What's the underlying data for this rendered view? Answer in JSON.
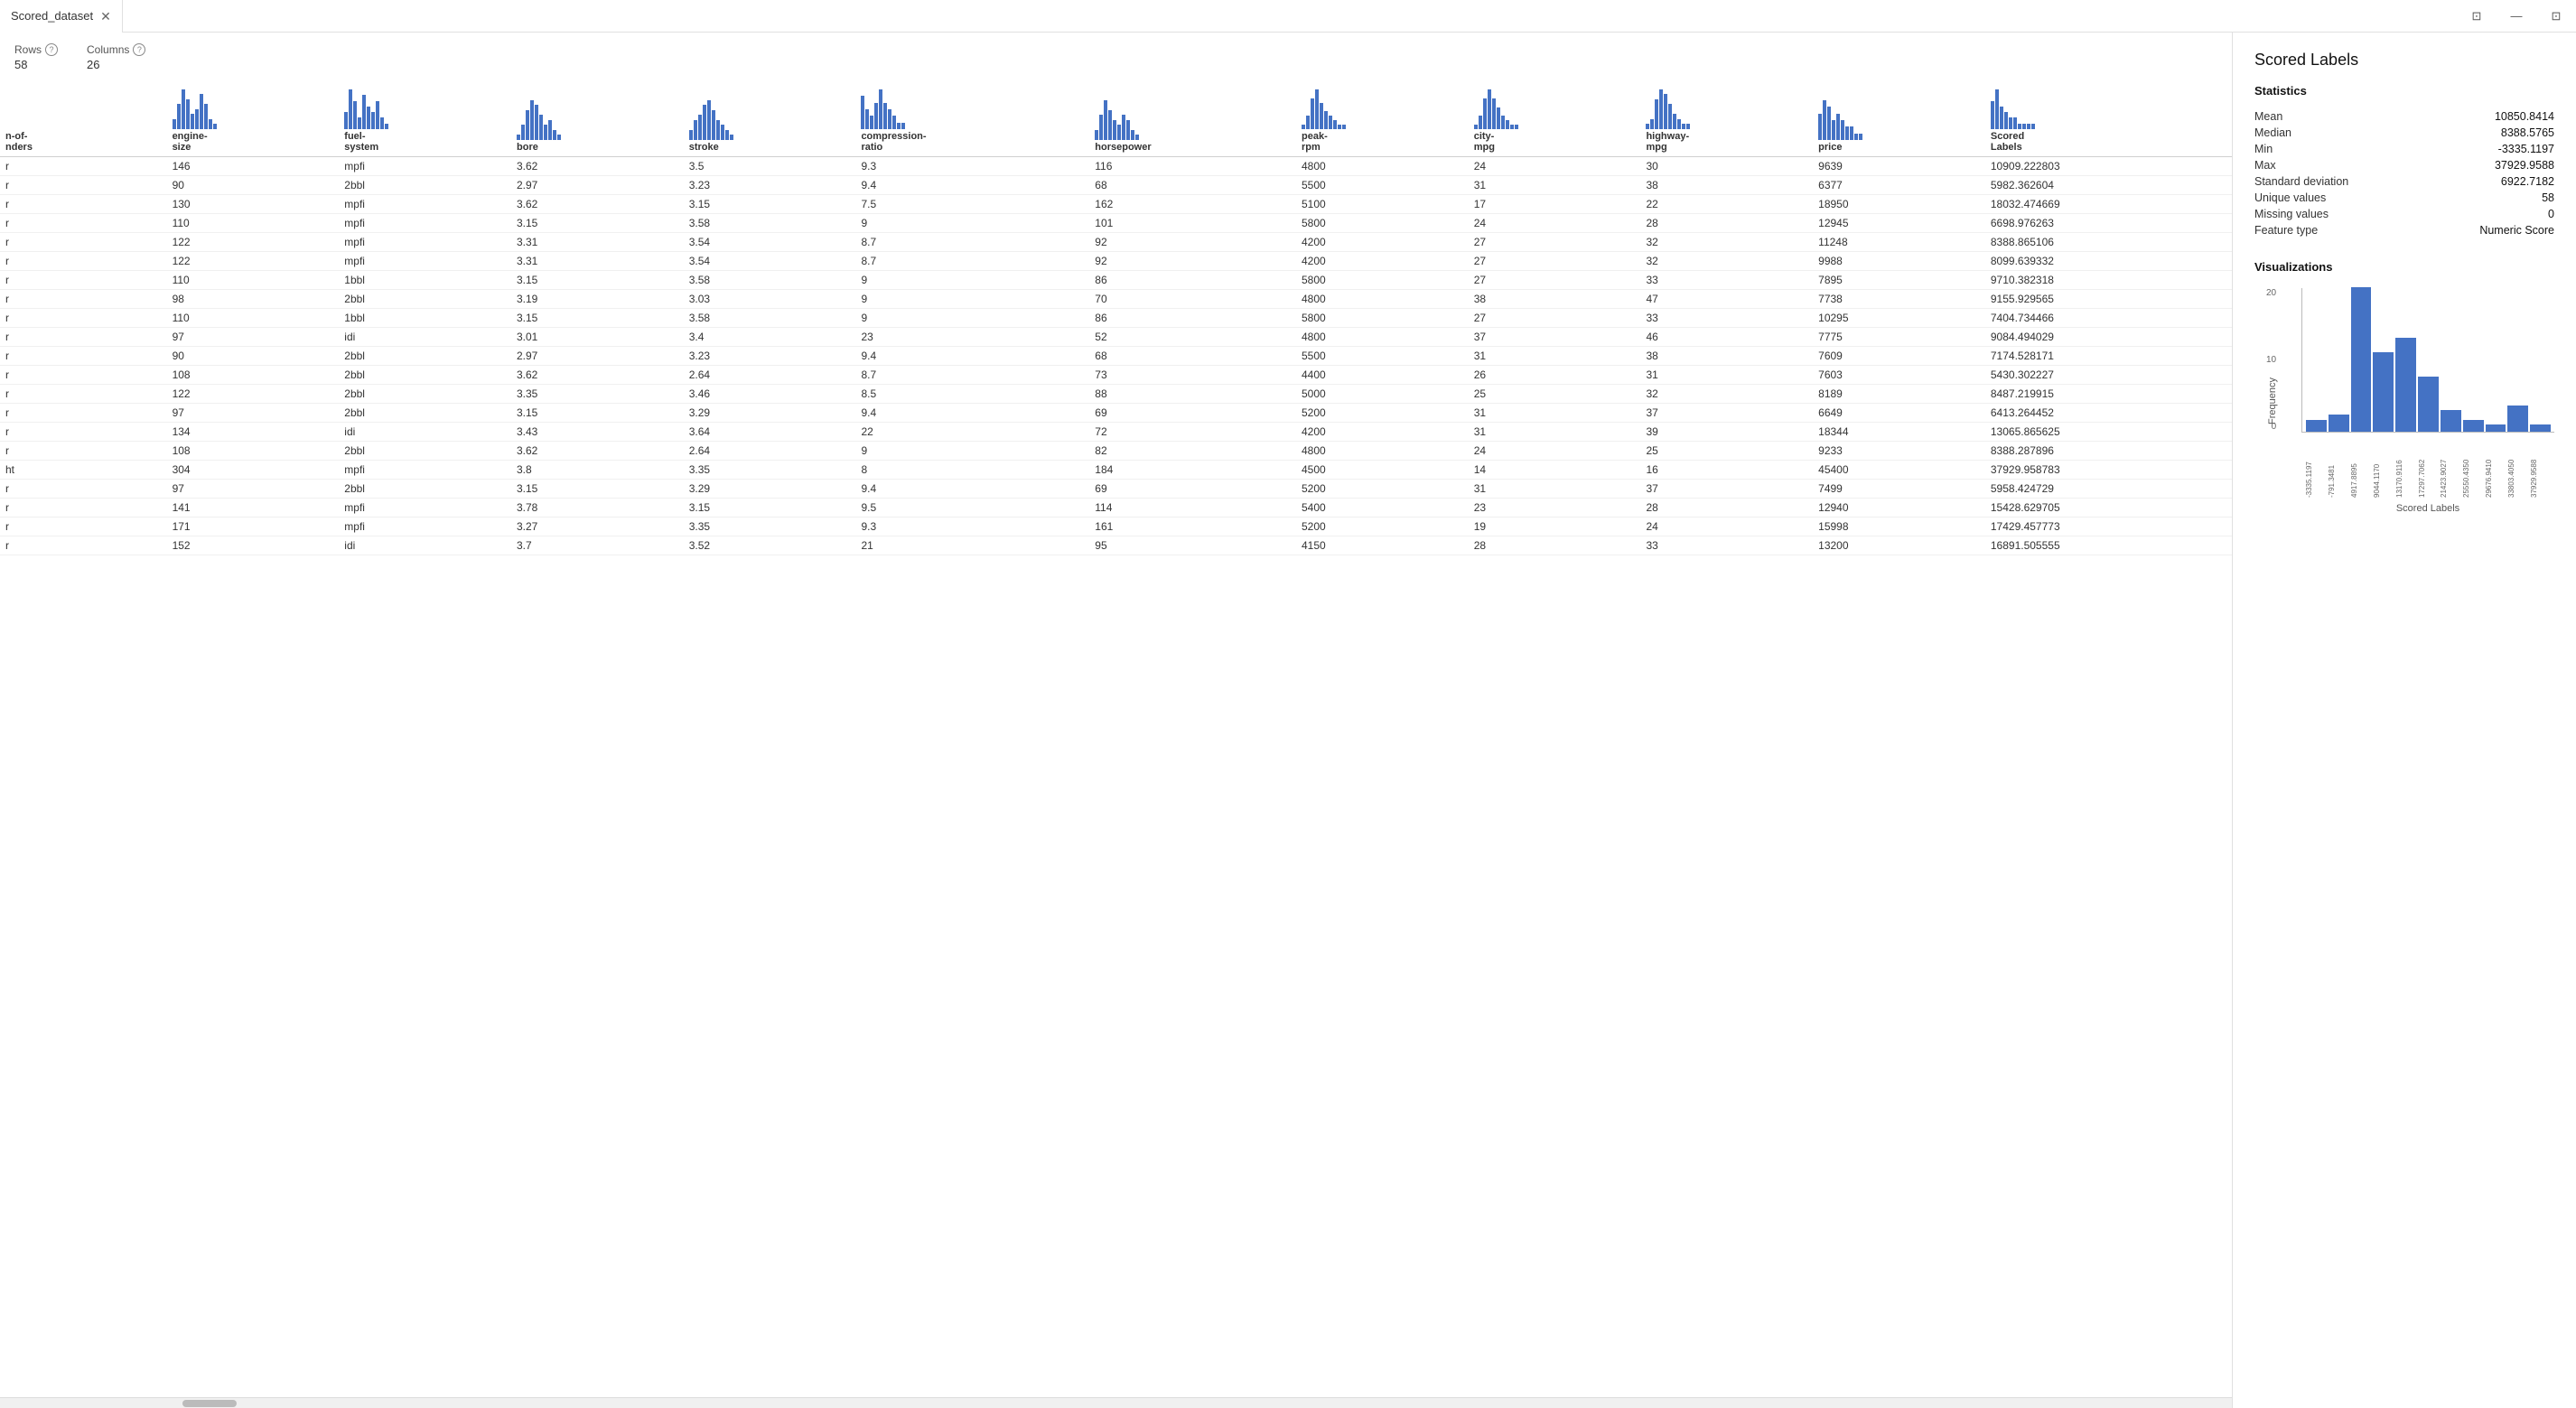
{
  "titleBar": {
    "tabName": "Scored_dataset",
    "closeIcon": "✕",
    "winControls": [
      "⊡",
      "—",
      "⊡"
    ]
  },
  "meta": {
    "rowsLabel": "Rows",
    "rowsValue": "58",
    "colsLabel": "Columns",
    "colsValue": "26"
  },
  "table": {
    "columns": [
      {
        "key": "num-of-cylinders",
        "label": "n-of-\nnders"
      },
      {
        "key": "engine-size",
        "label": "engine-\nsize"
      },
      {
        "key": "fuel-system",
        "label": "fuel-\nsystem"
      },
      {
        "key": "bore",
        "label": "bore"
      },
      {
        "key": "stroke",
        "label": "stroke"
      },
      {
        "key": "compression-ratio",
        "label": "compression-\nratio"
      },
      {
        "key": "horsepower",
        "label": "horsepower"
      },
      {
        "key": "peak-rpm",
        "label": "peak-\nrpm"
      },
      {
        "key": "city-mpg",
        "label": "city-\nmpg"
      },
      {
        "key": "highway-mpg",
        "label": "highway-\nmpg"
      },
      {
        "key": "price",
        "label": "price"
      },
      {
        "key": "scored-labels",
        "label": "Scored\nLabels"
      }
    ],
    "sparklines": {
      "engine-size": [
        2,
        5,
        8,
        6,
        3,
        4,
        7,
        5,
        2,
        1
      ],
      "fuel-system": [
        3,
        7,
        5,
        2,
        6,
        4,
        3,
        5,
        2,
        1
      ],
      "bore": [
        1,
        3,
        6,
        8,
        7,
        5,
        3,
        4,
        2,
        1
      ],
      "stroke": [
        2,
        4,
        5,
        7,
        8,
        6,
        4,
        3,
        2,
        1
      ],
      "compression-ratio": [
        5,
        3,
        2,
        4,
        6,
        4,
        3,
        2,
        1,
        1
      ],
      "horsepower": [
        2,
        5,
        8,
        6,
        4,
        3,
        5,
        4,
        2,
        1
      ],
      "peak-rpm": [
        1,
        3,
        7,
        9,
        6,
        4,
        3,
        2,
        1,
        1
      ],
      "city-mpg": [
        1,
        3,
        7,
        9,
        7,
        5,
        3,
        2,
        1,
        1
      ],
      "highway-mpg": [
        1,
        2,
        6,
        8,
        7,
        5,
        3,
        2,
        1,
        1
      ],
      "price": [
        4,
        6,
        5,
        3,
        4,
        3,
        2,
        2,
        1,
        1
      ],
      "scored-labels": [
        5,
        7,
        4,
        3,
        2,
        2,
        1,
        1,
        1,
        1
      ]
    },
    "rows": [
      [
        "r",
        "146",
        "mpfi",
        "3.62",
        "3.5",
        "9.3",
        "116",
        "4800",
        "24",
        "30",
        "9639",
        "10909.222803"
      ],
      [
        "r",
        "90",
        "2bbl",
        "2.97",
        "3.23",
        "9.4",
        "68",
        "5500",
        "31",
        "38",
        "6377",
        "5982.362604"
      ],
      [
        "r",
        "130",
        "mpfi",
        "3.62",
        "3.15",
        "7.5",
        "162",
        "5100",
        "17",
        "22",
        "18950",
        "18032.474669"
      ],
      [
        "r",
        "110",
        "mpfi",
        "3.15",
        "3.58",
        "9",
        "101",
        "5800",
        "24",
        "28",
        "12945",
        "6698.976263"
      ],
      [
        "r",
        "122",
        "mpfi",
        "3.31",
        "3.54",
        "8.7",
        "92",
        "4200",
        "27",
        "32",
        "11248",
        "8388.865106"
      ],
      [
        "r",
        "122",
        "mpfi",
        "3.31",
        "3.54",
        "8.7",
        "92",
        "4200",
        "27",
        "32",
        "9988",
        "8099.639332"
      ],
      [
        "r",
        "110",
        "1bbl",
        "3.15",
        "3.58",
        "9",
        "86",
        "5800",
        "27",
        "33",
        "7895",
        "9710.382318"
      ],
      [
        "r",
        "98",
        "2bbl",
        "3.19",
        "3.03",
        "9",
        "70",
        "4800",
        "38",
        "47",
        "7738",
        "9155.929565"
      ],
      [
        "r",
        "110",
        "1bbl",
        "3.15",
        "3.58",
        "9",
        "86",
        "5800",
        "27",
        "33",
        "10295",
        "7404.734466"
      ],
      [
        "r",
        "97",
        "idi",
        "3.01",
        "3.4",
        "23",
        "52",
        "4800",
        "37",
        "46",
        "7775",
        "9084.494029"
      ],
      [
        "r",
        "90",
        "2bbl",
        "2.97",
        "3.23",
        "9.4",
        "68",
        "5500",
        "31",
        "38",
        "7609",
        "7174.528171"
      ],
      [
        "r",
        "108",
        "2bbl",
        "3.62",
        "2.64",
        "8.7",
        "73",
        "4400",
        "26",
        "31",
        "7603",
        "5430.302227"
      ],
      [
        "r",
        "122",
        "2bbl",
        "3.35",
        "3.46",
        "8.5",
        "88",
        "5000",
        "25",
        "32",
        "8189",
        "8487.219915"
      ],
      [
        "r",
        "97",
        "2bbl",
        "3.15",
        "3.29",
        "9.4",
        "69",
        "5200",
        "31",
        "37",
        "6649",
        "6413.264452"
      ],
      [
        "r",
        "134",
        "idi",
        "3.43",
        "3.64",
        "22",
        "72",
        "4200",
        "31",
        "39",
        "18344",
        "13065.865625"
      ],
      [
        "r",
        "108",
        "2bbl",
        "3.62",
        "2.64",
        "9",
        "82",
        "4800",
        "24",
        "25",
        "9233",
        "8388.287896"
      ],
      [
        "ht",
        "304",
        "mpfi",
        "3.8",
        "3.35",
        "8",
        "184",
        "4500",
        "14",
        "16",
        "45400",
        "37929.958783"
      ],
      [
        "r",
        "97",
        "2bbl",
        "3.15",
        "3.29",
        "9.4",
        "69",
        "5200",
        "31",
        "37",
        "7499",
        "5958.424729"
      ],
      [
        "r",
        "141",
        "mpfi",
        "3.78",
        "3.15",
        "9.5",
        "114",
        "5400",
        "23",
        "28",
        "12940",
        "15428.629705"
      ],
      [
        "r",
        "171",
        "mpfi",
        "3.27",
        "3.35",
        "9.3",
        "161",
        "5200",
        "19",
        "24",
        "15998",
        "17429.457773"
      ],
      [
        "r",
        "152",
        "idi",
        "3.7",
        "3.52",
        "21",
        "95",
        "4150",
        "28",
        "33",
        "13200",
        "16891.505555"
      ]
    ]
  },
  "rightPanel": {
    "title": "Scored Labels",
    "statisticsLabel": "Statistics",
    "stats": [
      {
        "label": "Mean",
        "value": "10850.8414"
      },
      {
        "label": "Median",
        "value": "8388.5765"
      },
      {
        "label": "Min",
        "value": "-3335.1197"
      },
      {
        "label": "Max",
        "value": "37929.9588"
      },
      {
        "label": "Standard deviation",
        "value": "6922.7182"
      },
      {
        "label": "Unique values",
        "value": "58"
      },
      {
        "label": "Missing values",
        "value": "0"
      },
      {
        "label": "Feature type",
        "value": "Numeric Score"
      }
    ],
    "visualizationsLabel": "Visualizations",
    "histogram": {
      "yLabels": [
        "20",
        "10",
        "0"
      ],
      "bars": [
        {
          "height": 8,
          "label": "-3335.1197"
        },
        {
          "height": 12,
          "label": "-791.3481"
        },
        {
          "height": 100,
          "label": "4917.8895"
        },
        {
          "height": 55,
          "label": "9044.1170"
        },
        {
          "height": 65,
          "label": "13170.9116"
        },
        {
          "height": 38,
          "label": "17297.7062"
        },
        {
          "height": 15,
          "label": "21423.9027"
        },
        {
          "height": 8,
          "label": "25550.4350"
        },
        {
          "height": 5,
          "label": "29676.9410"
        },
        {
          "height": 18,
          "label": "33803.4050"
        },
        {
          "height": 5,
          "label": "37929.9588"
        }
      ],
      "xAxisTitle": "Scored Labels",
      "yAxisTitle": "Frequency"
    }
  }
}
